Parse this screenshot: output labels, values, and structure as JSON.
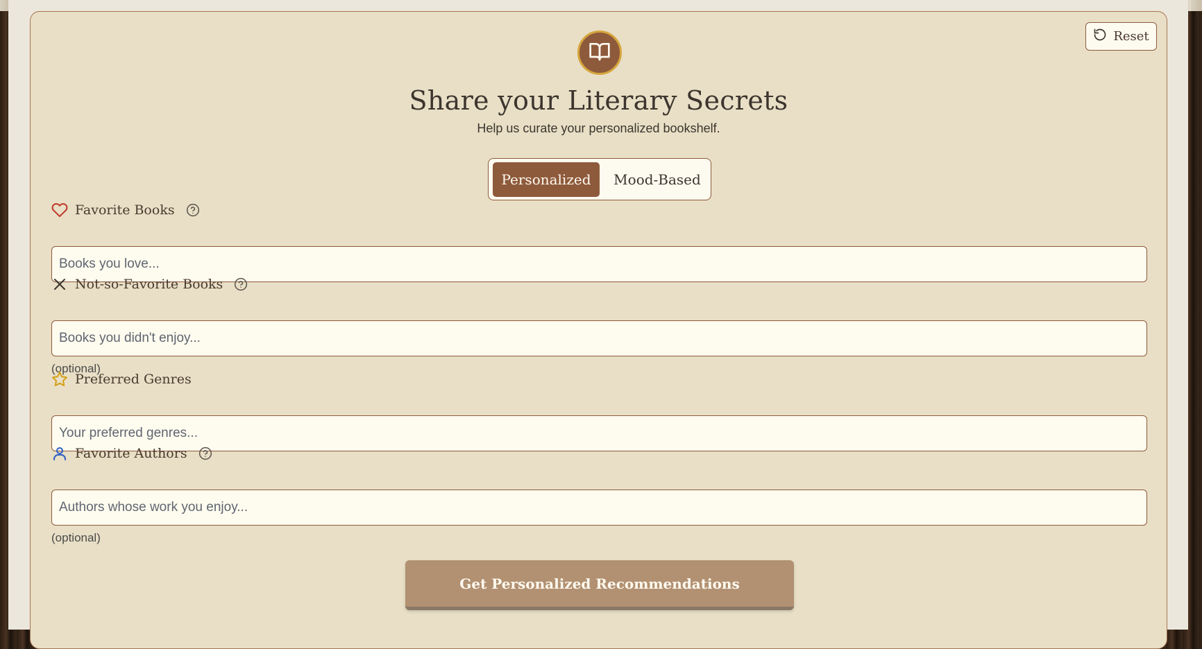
{
  "header": {
    "reset_label": "Reset",
    "title": "Share your Literary Secrets",
    "subtitle": "Help us curate your personalized bookshelf."
  },
  "mode_toggle": {
    "options": [
      "Personalized",
      "Mood-Based"
    ],
    "selected": "Personalized"
  },
  "fields": [
    {
      "label": "Favorite Books",
      "icon": "heart-icon",
      "placeholder": "Books you love...",
      "value": "",
      "has_help": true,
      "optional_note": ""
    },
    {
      "label": "Not-so-Favorite Books",
      "icon": "x-icon",
      "placeholder": "Books you didn't enjoy...",
      "value": "",
      "has_help": true,
      "optional_note": "(optional)"
    },
    {
      "label": "Preferred Genres",
      "icon": "star-icon",
      "placeholder": "Your preferred genres...",
      "value": "",
      "has_help": false,
      "optional_note": ""
    },
    {
      "label": "Favorite Authors",
      "icon": "user-icon",
      "placeholder": "Authors whose work you enjoy...",
      "value": "",
      "has_help": true,
      "optional_note": "(optional)"
    }
  ],
  "submit": {
    "label": "Get Personalized Recommendations"
  },
  "colors": {
    "card_bg": "#e8dfc6",
    "accent_brown": "#8e5a3c",
    "badge_ring_gold": "#d6a53c",
    "heart_red": "#c0392b",
    "star_gold": "#d4a017",
    "user_blue": "#2f5fc4",
    "submit_bg": "#b29172"
  }
}
